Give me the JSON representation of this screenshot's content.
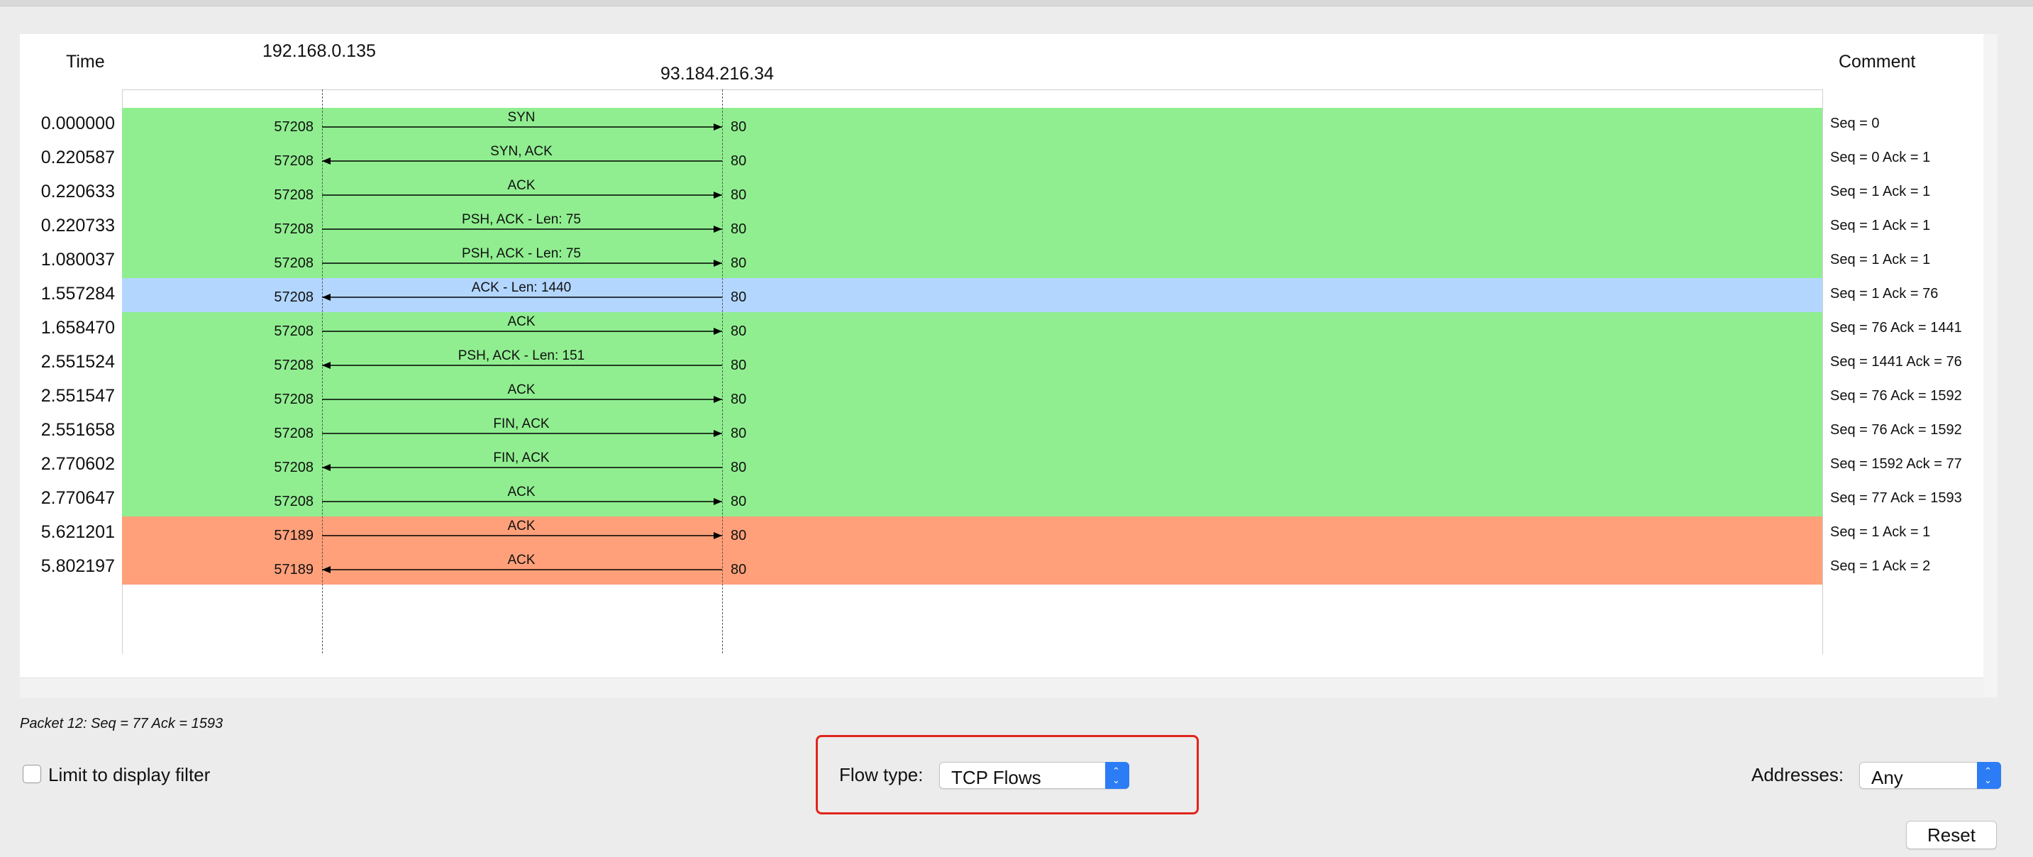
{
  "header": {
    "time_label": "Time",
    "host_a": "192.168.0.135",
    "host_b": "93.184.216.34",
    "comment_label": "Comment"
  },
  "colors": {
    "green": "#90ee90",
    "blue": "#b3d6ff",
    "orange": "#ffa07a"
  },
  "flows": [
    {
      "time": "0.000000",
      "src_port": "57208",
      "dst_port": "80",
      "label": "SYN",
      "direction": "right",
      "comment": "Seq = 0",
      "color": "green"
    },
    {
      "time": "0.220587",
      "src_port": "57208",
      "dst_port": "80",
      "label": "SYN, ACK",
      "direction": "left",
      "comment": "Seq = 0 Ack = 1",
      "color": "green"
    },
    {
      "time": "0.220633",
      "src_port": "57208",
      "dst_port": "80",
      "label": "ACK",
      "direction": "right",
      "comment": "Seq = 1 Ack = 1",
      "color": "green"
    },
    {
      "time": "0.220733",
      "src_port": "57208",
      "dst_port": "80",
      "label": "PSH, ACK - Len: 75",
      "direction": "right",
      "comment": "Seq = 1 Ack = 1",
      "color": "green"
    },
    {
      "time": "1.080037",
      "src_port": "57208",
      "dst_port": "80",
      "label": "PSH, ACK - Len: 75",
      "direction": "right",
      "comment": "Seq = 1 Ack = 1",
      "color": "green"
    },
    {
      "time": "1.557284",
      "src_port": "57208",
      "dst_port": "80",
      "label": "ACK - Len: 1440",
      "direction": "left",
      "comment": "Seq = 1 Ack = 76",
      "color": "blue"
    },
    {
      "time": "1.658470",
      "src_port": "57208",
      "dst_port": "80",
      "label": "ACK",
      "direction": "right",
      "comment": "Seq = 76 Ack = 1441",
      "color": "green"
    },
    {
      "time": "2.551524",
      "src_port": "57208",
      "dst_port": "80",
      "label": "PSH, ACK - Len: 151",
      "direction": "left",
      "comment": "Seq = 1441 Ack = 76",
      "color": "green"
    },
    {
      "time": "2.551547",
      "src_port": "57208",
      "dst_port": "80",
      "label": "ACK",
      "direction": "right",
      "comment": "Seq = 76 Ack = 1592",
      "color": "green"
    },
    {
      "time": "2.551658",
      "src_port": "57208",
      "dst_port": "80",
      "label": "FIN, ACK",
      "direction": "right",
      "comment": "Seq = 76 Ack = 1592",
      "color": "green"
    },
    {
      "time": "2.770602",
      "src_port": "57208",
      "dst_port": "80",
      "label": "FIN, ACK",
      "direction": "left",
      "comment": "Seq = 1592 Ack = 77",
      "color": "green"
    },
    {
      "time": "2.770647",
      "src_port": "57208",
      "dst_port": "80",
      "label": "ACK",
      "direction": "right",
      "comment": "Seq = 77 Ack = 1593",
      "color": "green"
    },
    {
      "time": "5.621201",
      "src_port": "57189",
      "dst_port": "80",
      "label": "ACK",
      "direction": "right",
      "comment": "Seq = 1 Ack = 1",
      "color": "orange"
    },
    {
      "time": "5.802197",
      "src_port": "57189",
      "dst_port": "80",
      "label": "ACK",
      "direction": "left",
      "comment": "Seq = 1 Ack = 2",
      "color": "orange"
    }
  ],
  "status_text": "Packet 12: Seq = 77 Ack = 1593",
  "controls": {
    "limit_filter_label": "Limit to display filter",
    "limit_filter_checked": false,
    "flow_type_label": "Flow type:",
    "flow_type_value": "TCP Flows",
    "addresses_label": "Addresses:",
    "addresses_value": "Any",
    "reset_label": "Reset"
  }
}
